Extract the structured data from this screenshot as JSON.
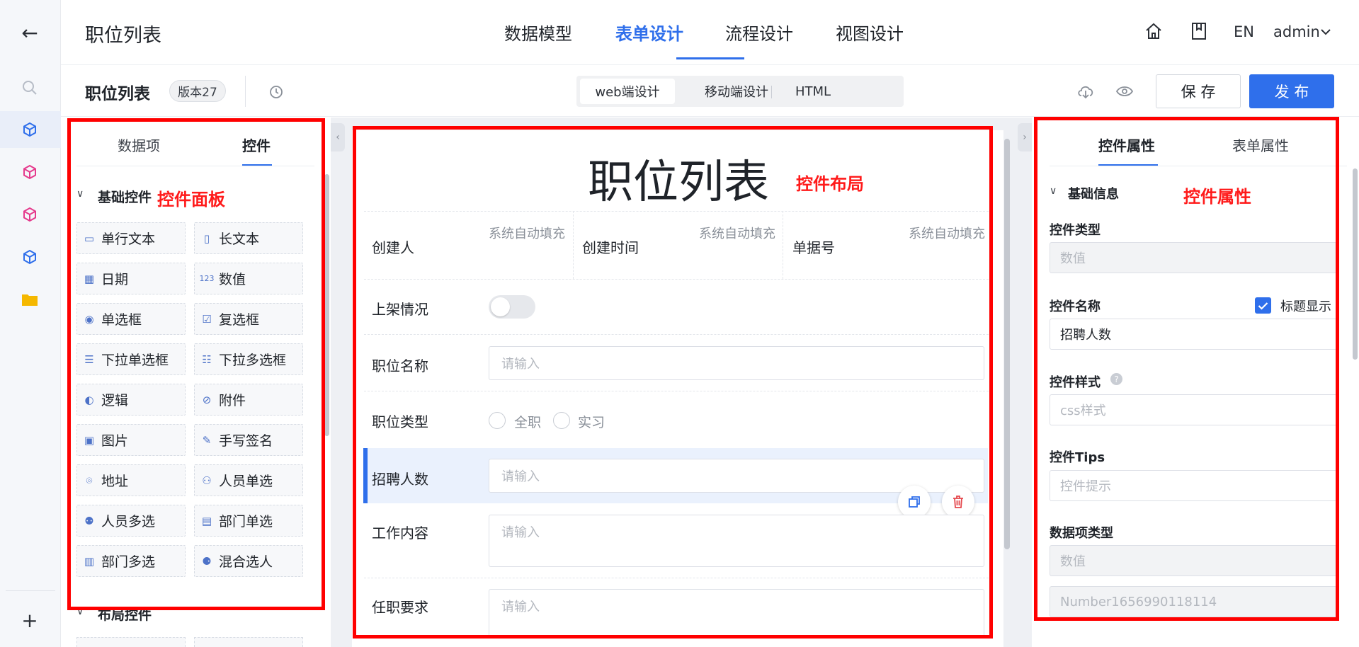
{
  "app": {
    "title": "职位列表"
  },
  "nav": {
    "tabs": [
      "数据模型",
      "表单设计",
      "流程设计",
      "视图设计"
    ],
    "active": "表单设计"
  },
  "header_right": {
    "lang": "EN",
    "user": "admin"
  },
  "toolbar": {
    "form_name": "职位列表",
    "version": "版本27",
    "modes": [
      "web端设计",
      "移动端设计",
      "HTML"
    ],
    "save_label": "保 存",
    "publish_label": "发 布"
  },
  "left_panel": {
    "tabs": [
      "数据项",
      "控件"
    ],
    "section_basic": "基础控件",
    "section_layout": "布局控件",
    "annotation": "控件面板",
    "controls": [
      "单行文本",
      "长文本",
      "日期",
      "数值",
      "单选框",
      "复选框",
      "下拉单选框",
      "下拉多选框",
      "逻辑",
      "附件",
      "图片",
      "手写签名",
      "地址",
      "人员单选",
      "人员多选",
      "部门单选",
      "部门多选",
      "混合选人"
    ]
  },
  "canvas": {
    "title": "职位列表",
    "annotation": "控件布局",
    "meta": [
      {
        "label": "创建人",
        "value": "系统自动填充"
      },
      {
        "label": "创建时间",
        "value": "系统自动填充"
      },
      {
        "label": "单据号",
        "value": "系统自动填充"
      }
    ],
    "fields": {
      "shelf": "上架情况",
      "name": "职位名称",
      "type": "职位类型",
      "type_options": [
        "全职",
        "实习"
      ],
      "count": "招聘人数",
      "content": "工作内容",
      "req": "任职要求",
      "placeholder": "请输入"
    }
  },
  "right_panel": {
    "tabs": [
      "控件属性",
      "表单属性"
    ],
    "section": "基础信息",
    "annotation": "控件属性",
    "ctrl_type_label": "控件类型",
    "ctrl_type_value": "数值",
    "ctrl_name_label": "控件名称",
    "show_title_label": "标题显示",
    "ctrl_name_value": "招聘人数",
    "ctrl_style_label": "控件样式",
    "ctrl_style_placeholder": "css样式",
    "tips_label": "控件Tips",
    "tips_placeholder": "控件提示",
    "data_type_label": "数据项类型",
    "data_type_value": "数值",
    "code_value": "Number1656990118114"
  },
  "colors": {
    "accent": "#2f6feb",
    "annotation": "#ff0000"
  }
}
